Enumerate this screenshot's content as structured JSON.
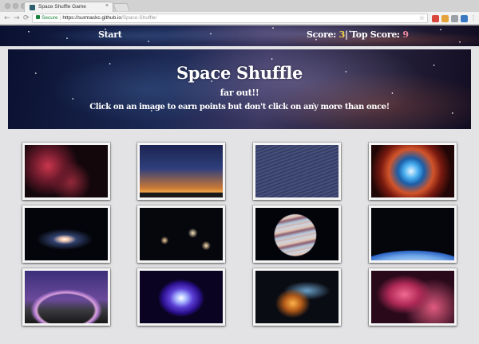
{
  "browser": {
    "tab_title": "Space Shuffle Game",
    "tab_close": "×",
    "secure_label": "Secure",
    "url_host": "https://surmackc.github.io",
    "url_path": "/Space-Shuffle/",
    "nav_back": "←",
    "nav_forward": "→",
    "nav_reload": "⟳",
    "bookmark": "☆"
  },
  "header": {
    "start_label": "Start",
    "score_label": "Score:",
    "score_value": "3",
    "divider": "|",
    "top_score_label": "Top Score:",
    "top_score_value": "9"
  },
  "hero": {
    "title": "Space Shuffle",
    "subtitle": "far out!!",
    "instructions": "Click on an image to earn points but don't click on any more than once!"
  },
  "images": [
    {
      "name": "red-nebula-image",
      "bg": "radial-gradient(circle at 28% 40%, #c9364c 0%, #6e1a2c 22%, transparent 45%), radial-gradient(circle at 55% 70%, #9a2a3c 0%, transparent 35%), #14070c"
    },
    {
      "name": "milky-way-rocks-image",
      "bg": "linear-gradient(180deg, #1b2350 0%, #2f3f7c 45%, #c97935 82%, #f0a54a 90%, #1a1a1a 91%)"
    },
    {
      "name": "star-trails-mountains-image",
      "bg": "repeating-linear-gradient(160deg, #38406a 0px, #4b5480 2px, #2b3358 4px), linear-gradient(180deg, transparent 70%, #2a2220 72%, #c2b6a5 82%, #3d3430 100%)"
    },
    {
      "name": "blue-orange-nebula-image",
      "bg": "radial-gradient(circle at 48% 50%, #e8f4ff 0%, #4ab0f0 14%, #1a5ea8 26%, #d2542a 44%, #7a1a10 60%, #200606 80%)"
    },
    {
      "name": "spiral-galaxy-image",
      "bg": "radial-gradient(ellipse 14% 9% at 48% 60%, #fff 0%, #ffd0b0 30%, transparent 100%), radial-gradient(ellipse 34% 20% at 48% 60%, rgba(90,120,200,0.9), transparent 100%), #04050a"
    },
    {
      "name": "galaxy-cluster-image",
      "bg": "radial-gradient(circle at 64% 48%, #ffe9c0 0%, transparent 8%), radial-gradient(circle at 30% 62%, #ffd7a0 0%, transparent 6%), radial-gradient(circle at 80% 72%, #ffe0b0 0%, transparent 6%), #05070d"
    },
    {
      "name": "jupiter-image",
      "bg": "radial-gradient(circle at 48% 52%, transparent 40%, #03030a 42%), repeating-linear-gradient(168deg, #c7d6e8 0px, #e1c5b5 5px, #8a5e70 8px, #b8cce0 12px, #d6b3a8 16px)"
    },
    {
      "name": "earth-horizon-image",
      "bg": "radial-gradient(ellipse 120% 60% at 50% 115%, #eaf4ff 0%, #6fa6e8 40%, #2b63c4 55%, transparent 57%), #05060c"
    },
    {
      "name": "milky-way-arch-image",
      "bg": "radial-gradient(ellipse 60% 55% at 50% 75%, transparent 55%, #d9a4d8 60%, #b27bd0 64%, transparent 72%), linear-gradient(180deg, #3b2f7a 0%, #6b4a9a 55%, #3a3a40 75%, #181818 100%)"
    },
    {
      "name": "crab-nebula-image",
      "bg": "radial-gradient(ellipse 35% 45% at 50% 52%, #ffffff 0%, #a9b8ff 18%, #5b3fd6 40%, #2a0f8a 65%, transparent 80%), #0a0422"
    },
    {
      "name": "orange-nebula-image",
      "bg": "radial-gradient(ellipse 30% 40% at 45% 62%, #ffb24a 0%, #b25a18 35%, transparent 70%), radial-gradient(ellipse 40% 25% at 62% 38%, #6aa0c8 0%, transparent 70%), #0a0c14"
    },
    {
      "name": "pink-nebula-image",
      "bg": "radial-gradient(ellipse 45% 50% at 40% 45%, #f06a92 0%, #b22a58 40%, transparent 75%), radial-gradient(circle at 75% 70%, #e05a80 0%, transparent 40%), #2a0a1a"
    }
  ]
}
